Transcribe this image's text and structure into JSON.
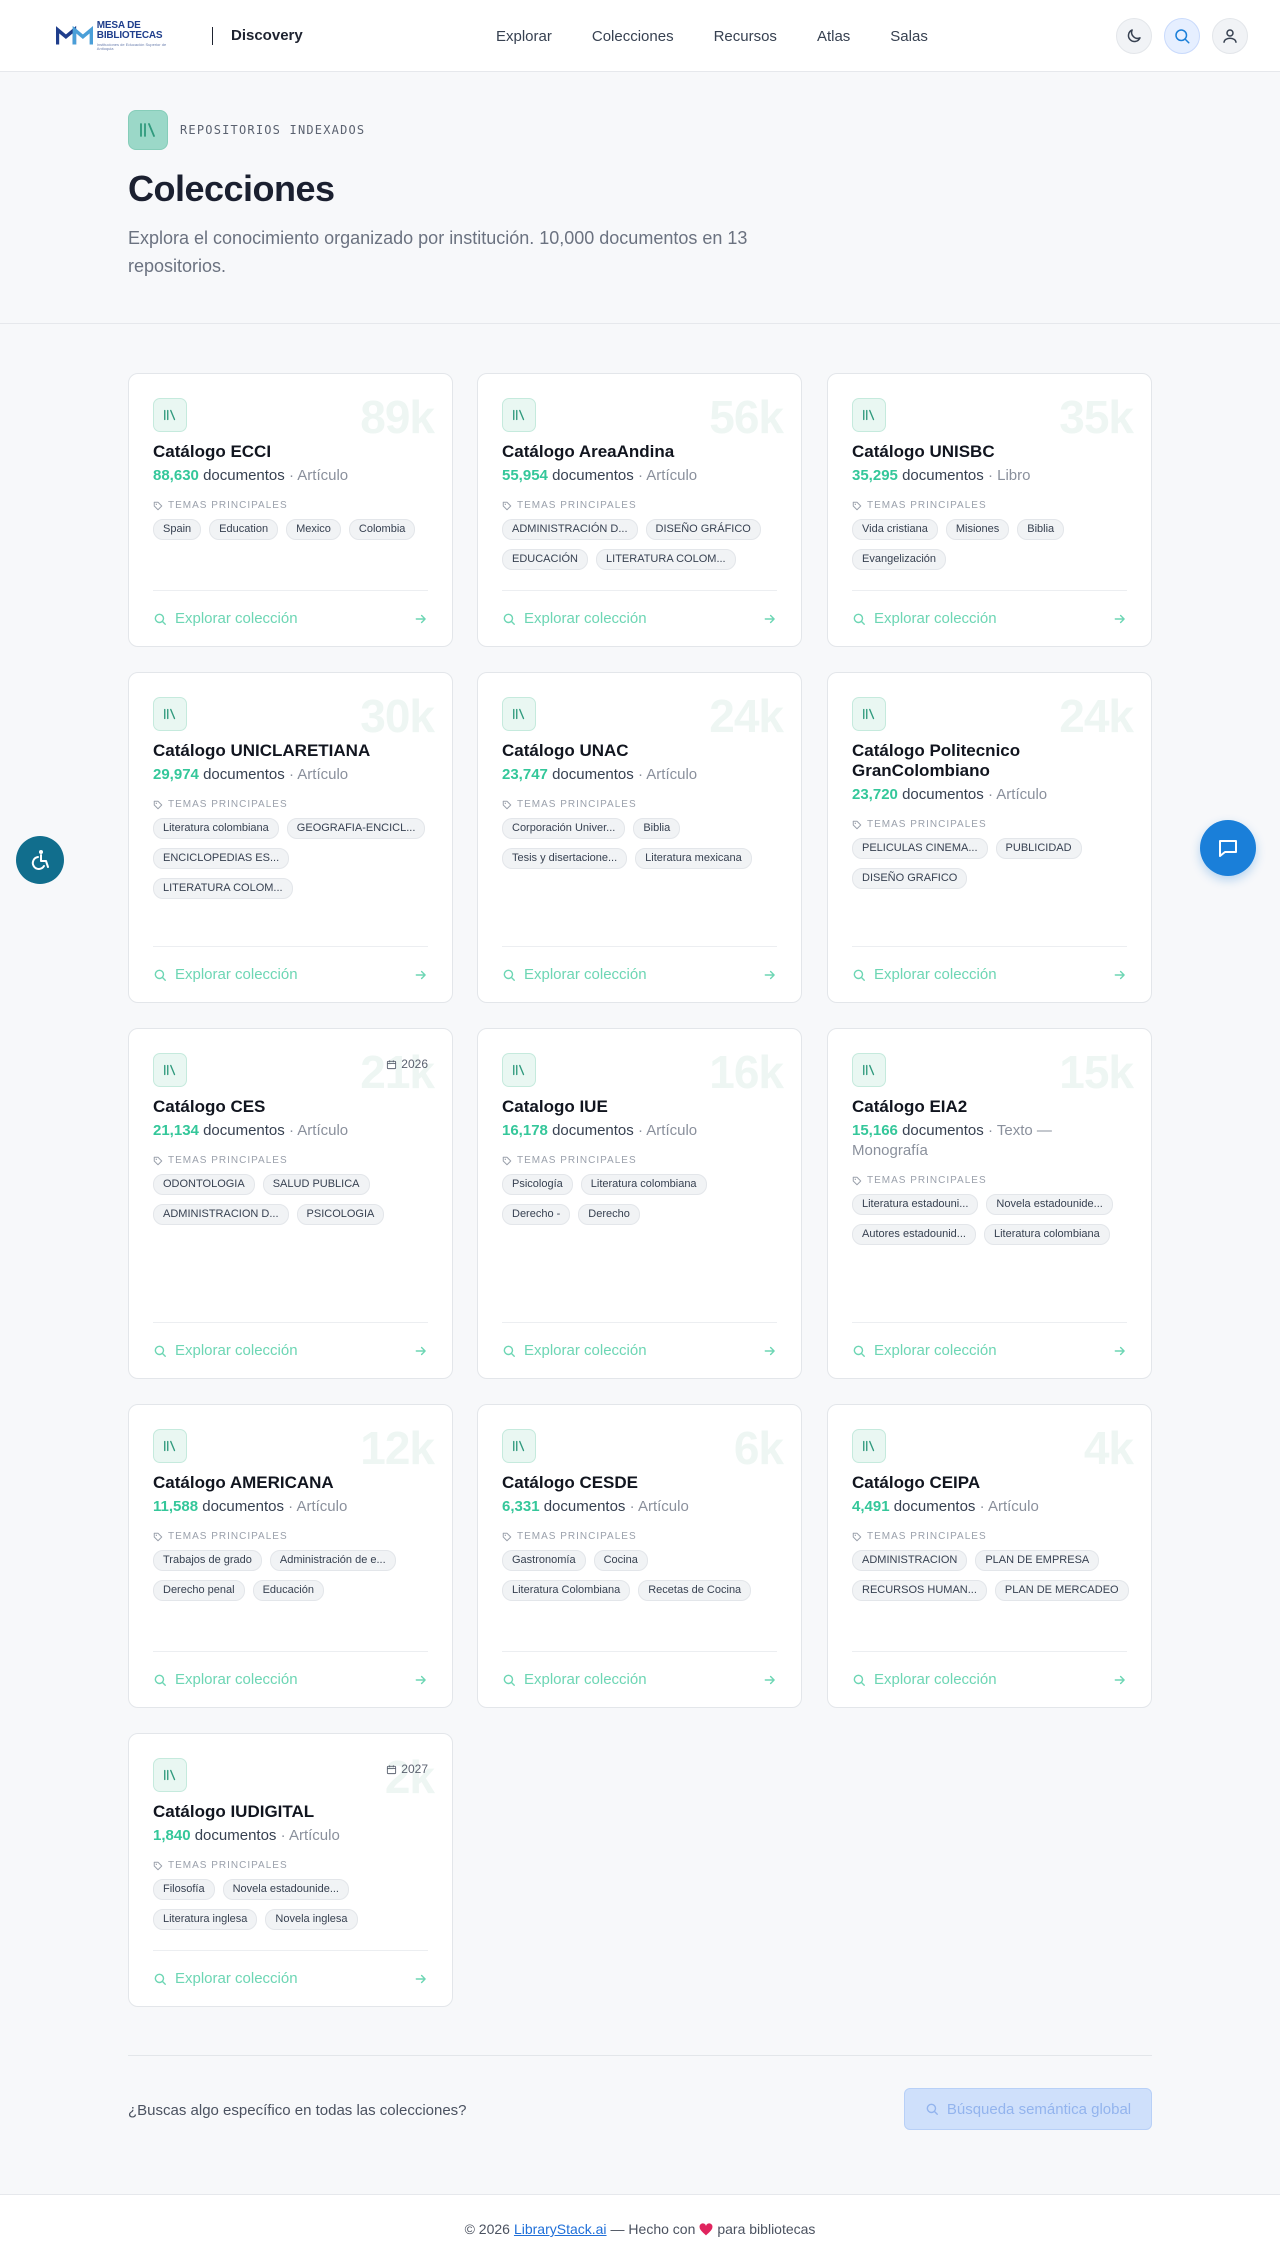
{
  "header": {
    "logo_main": "MESA DE BIBLIOTECAS",
    "logo_sub": "Instituciones de Educación Superior de Antioquia",
    "brand": "Discovery",
    "nav": [
      "Explorar",
      "Colecciones",
      "Recursos",
      "Atlas",
      "Salas"
    ]
  },
  "hero": {
    "tag": "REPOSITORIOS INDEXADOS",
    "title": "Colecciones",
    "description": "Explora el conocimiento organizado por institución. 10,000 documentos en 13 repositorios."
  },
  "labels": {
    "temas": "TEMAS PRINCIPALES",
    "documentos": "documentos",
    "explore": "Explorar colección"
  },
  "collections": [
    {
      "title": "Catálogo ECCI",
      "count": "88,630",
      "type": "Artículo",
      "bg": "89k",
      "year": "",
      "topics": [
        "Spain",
        "Education",
        "Mexico",
        "Colombia"
      ]
    },
    {
      "title": "Catálogo AreaAndina",
      "count": "55,954",
      "type": "Artículo",
      "bg": "56k",
      "year": "",
      "topics": [
        "ADMINISTRACIÓN D...",
        "DISEÑO GRÁFICO",
        "EDUCACIÓN",
        "LITERATURA COLOM..."
      ]
    },
    {
      "title": "Catálogo UNISBC",
      "count": "35,295",
      "type": "Libro",
      "bg": "35k",
      "year": "",
      "topics": [
        "Vida cristiana",
        "Misiones",
        "Biblia",
        "Evangelización"
      ]
    },
    {
      "title": "Catálogo UNICLARETIANA",
      "count": "29,974",
      "type": "Artículo",
      "bg": "30k",
      "year": "",
      "topics": [
        "Literatura colombiana",
        "GEOGRAFIA-ENCICL...",
        "ENCICLOPEDIAS ES...",
        "LITERATURA COLOM..."
      ]
    },
    {
      "title": "Catálogo UNAC",
      "count": "23,747",
      "type": "Artículo",
      "bg": "24k",
      "year": "",
      "topics": [
        "Corporación Univer...",
        "Biblia",
        "Tesis y disertacione...",
        "Literatura mexicana"
      ]
    },
    {
      "title": "Catálogo Politecnico GranColombiano",
      "count": "23,720",
      "type": "Artículo",
      "bg": "24k",
      "year": "",
      "topics": [
        "PELICULAS CINEMA...",
        "PUBLICIDAD",
        "DISEÑO GRAFICO"
      ]
    },
    {
      "title": "Catálogo CES",
      "count": "21,134",
      "type": "Artículo",
      "bg": "21k",
      "year": "2026",
      "topics": [
        "ODONTOLOGIA",
        "SALUD PUBLICA",
        "ADMINISTRACION D...",
        "PSICOLOGIA"
      ]
    },
    {
      "title": "Catalogo IUE",
      "count": "16,178",
      "type": "Artículo",
      "bg": "16k",
      "year": "",
      "topics": [
        "Psicología",
        "Literatura colombiana",
        "Derecho -",
        "Derecho"
      ]
    },
    {
      "title": "Catálogo EIA2",
      "count": "15,166",
      "type": "Texto — Monografía",
      "bg": "15k",
      "year": "",
      "topics": [
        "Literatura estadouni...",
        "Novela estadounide...",
        "Autores estadounid...",
        "Literatura colombiana"
      ]
    },
    {
      "title": "Catálogo AMERICANA",
      "count": "11,588",
      "type": "Artículo",
      "bg": "12k",
      "year": "",
      "topics": [
        "Trabajos de grado",
        "Administración de e...",
        "Derecho penal",
        "Educación"
      ]
    },
    {
      "title": "Catálogo CESDE",
      "count": "6,331",
      "type": "Artículo",
      "bg": "6k",
      "year": "",
      "topics": [
        "Gastronomía",
        "Cocina",
        "Literatura Colombiana",
        "Recetas de Cocina"
      ]
    },
    {
      "title": "Catálogo CEIPA",
      "count": "4,491",
      "type": "Artículo",
      "bg": "4k",
      "year": "",
      "topics": [
        "ADMINISTRACION",
        "PLAN DE EMPRESA",
        "RECURSOS HUMAN...",
        "PLAN DE MERCADEO"
      ]
    },
    {
      "title": "Catálogo IUDIGITAL",
      "count": "1,840",
      "type": "Artículo",
      "bg": "2k",
      "year": "2027",
      "topics": [
        "Filosofía",
        "Novela estadounide...",
        "Literatura inglesa",
        "Novela inglesa"
      ]
    }
  ],
  "bottom": {
    "question": "¿Buscas algo específico en todas las colecciones?",
    "button": "Búsqueda semántica global"
  },
  "footer": {
    "prefix": "© 2026",
    "link": "LibraryStack.ai",
    "middle": "— Hecho con",
    "suffix": "para bibliotecas"
  },
  "colors": {
    "accent": "#34c79a",
    "primary": "#1a7fd9",
    "heart": "#e0245e"
  }
}
